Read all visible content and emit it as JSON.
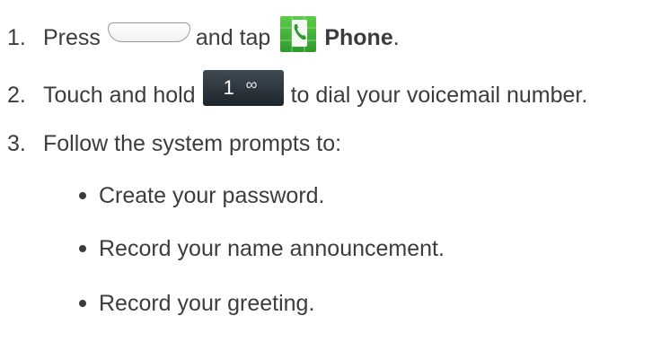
{
  "steps": [
    {
      "number": "1.",
      "text_before": "Press",
      "text_middle": "and tap",
      "app_name": "Phone",
      "text_end": "."
    },
    {
      "number": "2.",
      "text_before": "Touch and hold",
      "key_digit": "1",
      "key_symbol": "∞",
      "text_after": "to dial your voicemail number."
    },
    {
      "number": "3.",
      "text": "Follow the system prompts to:"
    }
  ],
  "bullets": [
    "Create your password.",
    "Record your name announcement.",
    "Record your greeting."
  ],
  "icons": {
    "home_key": "home-key-icon",
    "phone_app": "phone-app-icon",
    "voicemail_key": "voicemail-key-icon"
  },
  "colors": {
    "text": "#3c3c3c",
    "phone_icon_green": "#3aa83a",
    "key_background": "#2b343c"
  }
}
